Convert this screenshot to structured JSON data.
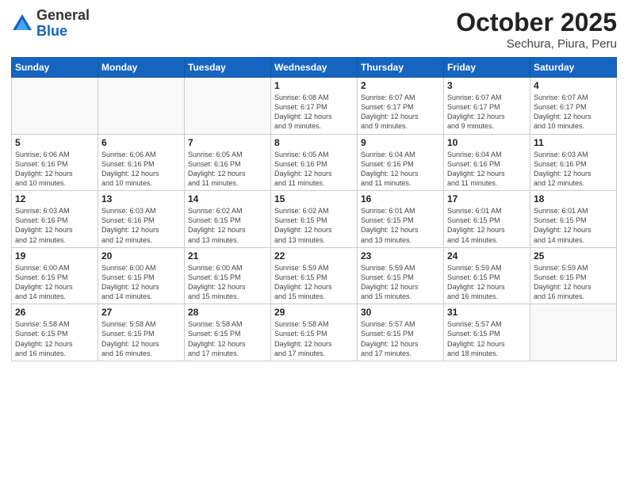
{
  "header": {
    "logo_general": "General",
    "logo_blue": "Blue",
    "month": "October 2025",
    "location": "Sechura, Piura, Peru"
  },
  "weekdays": [
    "Sunday",
    "Monday",
    "Tuesday",
    "Wednesday",
    "Thursday",
    "Friday",
    "Saturday"
  ],
  "weeks": [
    [
      {
        "day": "",
        "info": ""
      },
      {
        "day": "",
        "info": ""
      },
      {
        "day": "",
        "info": ""
      },
      {
        "day": "1",
        "info": "Sunrise: 6:08 AM\nSunset: 6:17 PM\nDaylight: 12 hours\nand 9 minutes."
      },
      {
        "day": "2",
        "info": "Sunrise: 6:07 AM\nSunset: 6:17 PM\nDaylight: 12 hours\nand 9 minutes."
      },
      {
        "day": "3",
        "info": "Sunrise: 6:07 AM\nSunset: 6:17 PM\nDaylight: 12 hours\nand 9 minutes."
      },
      {
        "day": "4",
        "info": "Sunrise: 6:07 AM\nSunset: 6:17 PM\nDaylight: 12 hours\nand 10 minutes."
      }
    ],
    [
      {
        "day": "5",
        "info": "Sunrise: 6:06 AM\nSunset: 6:16 PM\nDaylight: 12 hours\nand 10 minutes."
      },
      {
        "day": "6",
        "info": "Sunrise: 6:06 AM\nSunset: 6:16 PM\nDaylight: 12 hours\nand 10 minutes."
      },
      {
        "day": "7",
        "info": "Sunrise: 6:05 AM\nSunset: 6:16 PM\nDaylight: 12 hours\nand 11 minutes."
      },
      {
        "day": "8",
        "info": "Sunrise: 6:05 AM\nSunset: 6:16 PM\nDaylight: 12 hours\nand 11 minutes."
      },
      {
        "day": "9",
        "info": "Sunrise: 6:04 AM\nSunset: 6:16 PM\nDaylight: 12 hours\nand 11 minutes."
      },
      {
        "day": "10",
        "info": "Sunrise: 6:04 AM\nSunset: 6:16 PM\nDaylight: 12 hours\nand 11 minutes."
      },
      {
        "day": "11",
        "info": "Sunrise: 6:03 AM\nSunset: 6:16 PM\nDaylight: 12 hours\nand 12 minutes."
      }
    ],
    [
      {
        "day": "12",
        "info": "Sunrise: 6:03 AM\nSunset: 6:16 PM\nDaylight: 12 hours\nand 12 minutes."
      },
      {
        "day": "13",
        "info": "Sunrise: 6:03 AM\nSunset: 6:16 PM\nDaylight: 12 hours\nand 12 minutes."
      },
      {
        "day": "14",
        "info": "Sunrise: 6:02 AM\nSunset: 6:15 PM\nDaylight: 12 hours\nand 13 minutes."
      },
      {
        "day": "15",
        "info": "Sunrise: 6:02 AM\nSunset: 6:15 PM\nDaylight: 12 hours\nand 13 minutes."
      },
      {
        "day": "16",
        "info": "Sunrise: 6:01 AM\nSunset: 6:15 PM\nDaylight: 12 hours\nand 13 minutes."
      },
      {
        "day": "17",
        "info": "Sunrise: 6:01 AM\nSunset: 6:15 PM\nDaylight: 12 hours\nand 14 minutes."
      },
      {
        "day": "18",
        "info": "Sunrise: 6:01 AM\nSunset: 6:15 PM\nDaylight: 12 hours\nand 14 minutes."
      }
    ],
    [
      {
        "day": "19",
        "info": "Sunrise: 6:00 AM\nSunset: 6:15 PM\nDaylight: 12 hours\nand 14 minutes."
      },
      {
        "day": "20",
        "info": "Sunrise: 6:00 AM\nSunset: 6:15 PM\nDaylight: 12 hours\nand 14 minutes."
      },
      {
        "day": "21",
        "info": "Sunrise: 6:00 AM\nSunset: 6:15 PM\nDaylight: 12 hours\nand 15 minutes."
      },
      {
        "day": "22",
        "info": "Sunrise: 5:59 AM\nSunset: 6:15 PM\nDaylight: 12 hours\nand 15 minutes."
      },
      {
        "day": "23",
        "info": "Sunrise: 5:59 AM\nSunset: 6:15 PM\nDaylight: 12 hours\nand 15 minutes."
      },
      {
        "day": "24",
        "info": "Sunrise: 5:59 AM\nSunset: 6:15 PM\nDaylight: 12 hours\nand 16 minutes."
      },
      {
        "day": "25",
        "info": "Sunrise: 5:59 AM\nSunset: 6:15 PM\nDaylight: 12 hours\nand 16 minutes."
      }
    ],
    [
      {
        "day": "26",
        "info": "Sunrise: 5:58 AM\nSunset: 6:15 PM\nDaylight: 12 hours\nand 16 minutes."
      },
      {
        "day": "27",
        "info": "Sunrise: 5:58 AM\nSunset: 6:15 PM\nDaylight: 12 hours\nand 16 minutes."
      },
      {
        "day": "28",
        "info": "Sunrise: 5:58 AM\nSunset: 6:15 PM\nDaylight: 12 hours\nand 17 minutes."
      },
      {
        "day": "29",
        "info": "Sunrise: 5:58 AM\nSunset: 6:15 PM\nDaylight: 12 hours\nand 17 minutes."
      },
      {
        "day": "30",
        "info": "Sunrise: 5:57 AM\nSunset: 6:15 PM\nDaylight: 12 hours\nand 17 minutes."
      },
      {
        "day": "31",
        "info": "Sunrise: 5:57 AM\nSunset: 6:15 PM\nDaylight: 12 hours\nand 18 minutes."
      },
      {
        "day": "",
        "info": ""
      }
    ]
  ]
}
